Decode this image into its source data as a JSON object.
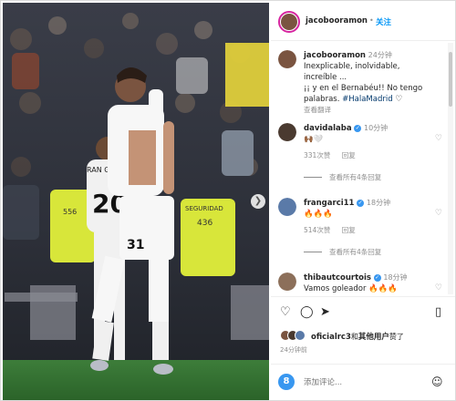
{
  "header": {
    "username": "jacobooramon",
    "separator": "•",
    "follow_label": "关注"
  },
  "caption": {
    "username": "jacobooramon",
    "time": "24分钟",
    "line1": "Inexplicable, inolvidable, increíble ...",
    "line2": "¡¡ y en el Bernabéu!! No tengo",
    "line3": "palabras.",
    "hashtag": "#HalaMadrid",
    "translate": "查看翻译"
  },
  "comments": [
    {
      "username": "davidalaba",
      "verified": true,
      "time": "10分钟",
      "text": "🙌🏾🤍",
      "likes": "331次赞",
      "reply": "回复",
      "view_replies": "查看所有4条回复"
    },
    {
      "username": "frangarci11",
      "verified": true,
      "time": "18分钟",
      "text": "🔥🔥🔥",
      "likes": "514次赞",
      "reply": "回复",
      "view_replies": "查看所有4条回复"
    },
    {
      "username": "thibautcourtois",
      "verified": true,
      "time": "18分钟",
      "text": "Vamos goleador 🔥🔥🔥"
    }
  ],
  "likes_line": {
    "user": "oficialrc3",
    "and": "和",
    "others": "其他用户",
    "suffix": "赞了"
  },
  "post_time": "24分钟前",
  "add_comment": {
    "placeholder": "添加评论..."
  },
  "icons": {
    "heart": "heart-icon",
    "comment": "comment-icon",
    "share": "share-icon",
    "save": "bookmark-icon",
    "emoji": "emoji-icon",
    "next": "chevron-right-icon"
  },
  "photo": {
    "sign_text": "SEGURIDAD",
    "sign_number": "436",
    "player_number_front": "31",
    "player_number_back": "20",
    "player_name_back": "RAN GAR"
  },
  "colors": {
    "accent": "#0095f6",
    "verified": "#3897f0",
    "vest": "#d8e63a"
  }
}
